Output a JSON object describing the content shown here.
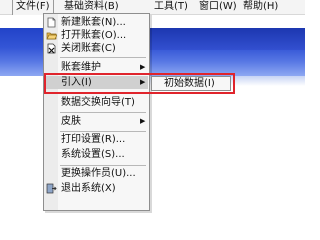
{
  "menubar": {
    "items": [
      {
        "label": "文件(F)",
        "open": true
      },
      {
        "label": "基础资料(B)"
      },
      {
        "label": "工具(T)"
      },
      {
        "label": "窗口(W)"
      },
      {
        "label": "帮助(H)"
      }
    ]
  },
  "file_menu": {
    "items": [
      {
        "label": "新建账套(N)...",
        "icon": "new-file-icon"
      },
      {
        "label": "打开账套(O)...",
        "icon": "open-folder-icon"
      },
      {
        "label": "关闭账套(C)",
        "icon": "close-file-icon"
      },
      {
        "label": "账套维护",
        "submenu": true
      },
      {
        "label": "引入(I)",
        "submenu": true,
        "highlighted": true
      },
      {
        "label": "数据交换向导(T)"
      },
      {
        "label": "皮肤",
        "submenu": true
      },
      {
        "label": "打印设置(R)..."
      },
      {
        "label": "系统设置(S)..."
      },
      {
        "label": "更换操作员(U)..."
      },
      {
        "label": "退出系统(X)",
        "icon": "exit-icon"
      }
    ]
  },
  "import_submenu": {
    "items": [
      {
        "label": "初始数据(I)"
      }
    ]
  },
  "colors": {
    "annotation": "#e0242c",
    "app_background": "#2243c8"
  }
}
